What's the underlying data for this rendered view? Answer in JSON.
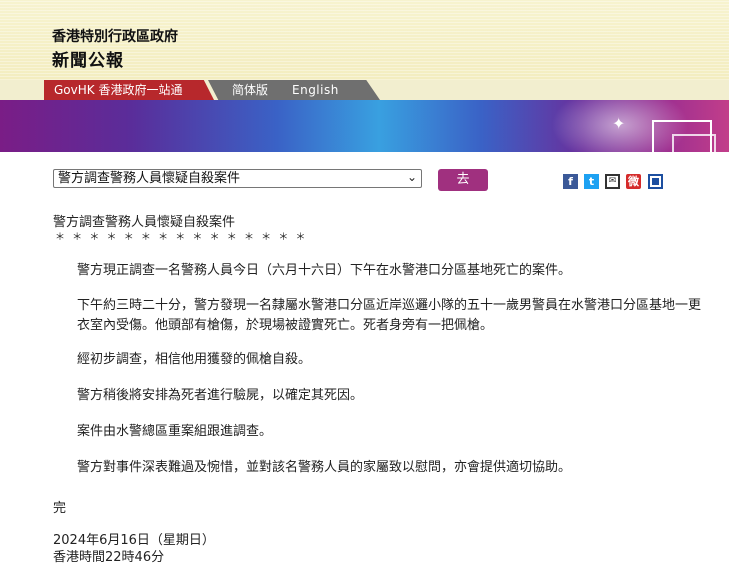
{
  "header": {
    "title": "香港特別行政區政府",
    "subtitle": "新聞公報"
  },
  "nav": {
    "govhk": "GovHK 香港政府一站通",
    "simplified": "简体版",
    "english": "English"
  },
  "selector": {
    "value": "警方調查警務人員懷疑自殺案件",
    "go_label": "去"
  },
  "share": {
    "facebook": "f",
    "twitter": "t",
    "mail": "✉",
    "weibo": "微"
  },
  "article": {
    "title": "警方調查警務人員懷疑自殺案件",
    "stars": "＊ ＊ ＊ ＊ ＊ ＊ ＊ ＊ ＊ ＊ ＊ ＊ ＊ ＊ ＊",
    "paragraphs": [
      "警方現正調查一名警務人員今日（六月十六日）下午在水警港口分區基地死亡的案件。",
      "下午約三時二十分，警方發現一名隸屬水警港口分區近岸巡邏小隊的五十一歲男警員在水警港口分區基地一更衣室內受傷。他頭部有槍傷，於現場被證實死亡。死者身旁有一把佩槍。",
      "經初步調查，相信他用獲發的佩槍自殺。",
      "警方稍後將安排為死者進行驗屍，以確定其死因。",
      "案件由水警總區重案組跟進調查。",
      "警方對事件深表難過及惋惜，並對該名警務人員的家屬致以慰問，亦會提供適切協助。"
    ],
    "end": "完",
    "date": "2024年6月16日（星期日）",
    "time": "香港時間22時46分"
  },
  "colors": {
    "govhk_red": "#b7282c",
    "go_button": "#a0307f"
  }
}
